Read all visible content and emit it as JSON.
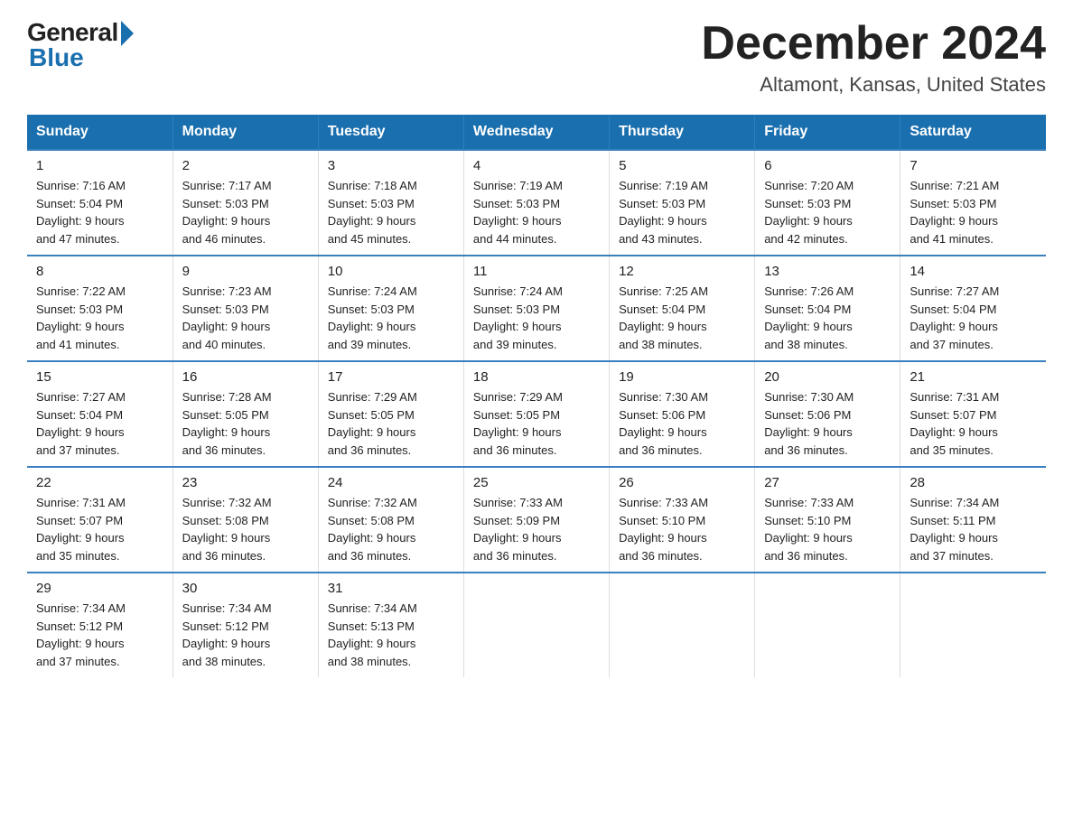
{
  "logo": {
    "general": "General",
    "blue": "Blue"
  },
  "title": "December 2024",
  "location": "Altamont, Kansas, United States",
  "days_of_week": [
    "Sunday",
    "Monday",
    "Tuesday",
    "Wednesday",
    "Thursday",
    "Friday",
    "Saturday"
  ],
  "weeks": [
    [
      {
        "day": "1",
        "sunrise": "7:16 AM",
        "sunset": "5:04 PM",
        "daylight": "9 hours and 47 minutes."
      },
      {
        "day": "2",
        "sunrise": "7:17 AM",
        "sunset": "5:03 PM",
        "daylight": "9 hours and 46 minutes."
      },
      {
        "day": "3",
        "sunrise": "7:18 AM",
        "sunset": "5:03 PM",
        "daylight": "9 hours and 45 minutes."
      },
      {
        "day": "4",
        "sunrise": "7:19 AM",
        "sunset": "5:03 PM",
        "daylight": "9 hours and 44 minutes."
      },
      {
        "day": "5",
        "sunrise": "7:19 AM",
        "sunset": "5:03 PM",
        "daylight": "9 hours and 43 minutes."
      },
      {
        "day": "6",
        "sunrise": "7:20 AM",
        "sunset": "5:03 PM",
        "daylight": "9 hours and 42 minutes."
      },
      {
        "day": "7",
        "sunrise": "7:21 AM",
        "sunset": "5:03 PM",
        "daylight": "9 hours and 41 minutes."
      }
    ],
    [
      {
        "day": "8",
        "sunrise": "7:22 AM",
        "sunset": "5:03 PM",
        "daylight": "9 hours and 41 minutes."
      },
      {
        "day": "9",
        "sunrise": "7:23 AM",
        "sunset": "5:03 PM",
        "daylight": "9 hours and 40 minutes."
      },
      {
        "day": "10",
        "sunrise": "7:24 AM",
        "sunset": "5:03 PM",
        "daylight": "9 hours and 39 minutes."
      },
      {
        "day": "11",
        "sunrise": "7:24 AM",
        "sunset": "5:03 PM",
        "daylight": "9 hours and 39 minutes."
      },
      {
        "day": "12",
        "sunrise": "7:25 AM",
        "sunset": "5:04 PM",
        "daylight": "9 hours and 38 minutes."
      },
      {
        "day": "13",
        "sunrise": "7:26 AM",
        "sunset": "5:04 PM",
        "daylight": "9 hours and 38 minutes."
      },
      {
        "day": "14",
        "sunrise": "7:27 AM",
        "sunset": "5:04 PM",
        "daylight": "9 hours and 37 minutes."
      }
    ],
    [
      {
        "day": "15",
        "sunrise": "7:27 AM",
        "sunset": "5:04 PM",
        "daylight": "9 hours and 37 minutes."
      },
      {
        "day": "16",
        "sunrise": "7:28 AM",
        "sunset": "5:05 PM",
        "daylight": "9 hours and 36 minutes."
      },
      {
        "day": "17",
        "sunrise": "7:29 AM",
        "sunset": "5:05 PM",
        "daylight": "9 hours and 36 minutes."
      },
      {
        "day": "18",
        "sunrise": "7:29 AM",
        "sunset": "5:05 PM",
        "daylight": "9 hours and 36 minutes."
      },
      {
        "day": "19",
        "sunrise": "7:30 AM",
        "sunset": "5:06 PM",
        "daylight": "9 hours and 36 minutes."
      },
      {
        "day": "20",
        "sunrise": "7:30 AM",
        "sunset": "5:06 PM",
        "daylight": "9 hours and 36 minutes."
      },
      {
        "day": "21",
        "sunrise": "7:31 AM",
        "sunset": "5:07 PM",
        "daylight": "9 hours and 35 minutes."
      }
    ],
    [
      {
        "day": "22",
        "sunrise": "7:31 AM",
        "sunset": "5:07 PM",
        "daylight": "9 hours and 35 minutes."
      },
      {
        "day": "23",
        "sunrise": "7:32 AM",
        "sunset": "5:08 PM",
        "daylight": "9 hours and 36 minutes."
      },
      {
        "day": "24",
        "sunrise": "7:32 AM",
        "sunset": "5:08 PM",
        "daylight": "9 hours and 36 minutes."
      },
      {
        "day": "25",
        "sunrise": "7:33 AM",
        "sunset": "5:09 PM",
        "daylight": "9 hours and 36 minutes."
      },
      {
        "day": "26",
        "sunrise": "7:33 AM",
        "sunset": "5:10 PM",
        "daylight": "9 hours and 36 minutes."
      },
      {
        "day": "27",
        "sunrise": "7:33 AM",
        "sunset": "5:10 PM",
        "daylight": "9 hours and 36 minutes."
      },
      {
        "day": "28",
        "sunrise": "7:34 AM",
        "sunset": "5:11 PM",
        "daylight": "9 hours and 37 minutes."
      }
    ],
    [
      {
        "day": "29",
        "sunrise": "7:34 AM",
        "sunset": "5:12 PM",
        "daylight": "9 hours and 37 minutes."
      },
      {
        "day": "30",
        "sunrise": "7:34 AM",
        "sunset": "5:12 PM",
        "daylight": "9 hours and 38 minutes."
      },
      {
        "day": "31",
        "sunrise": "7:34 AM",
        "sunset": "5:13 PM",
        "daylight": "9 hours and 38 minutes."
      },
      null,
      null,
      null,
      null
    ]
  ],
  "labels": {
    "sunrise": "Sunrise:",
    "sunset": "Sunset:",
    "daylight": "Daylight:"
  }
}
